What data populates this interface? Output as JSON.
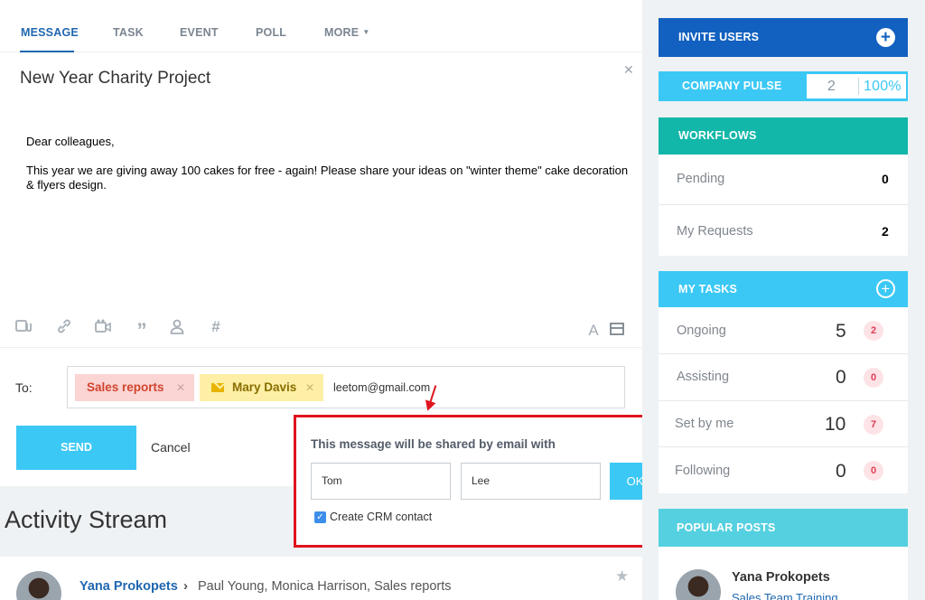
{
  "tabs": [
    {
      "label": "MESSAGE"
    },
    {
      "label": "TASK"
    },
    {
      "label": "EVENT"
    },
    {
      "label": "POLL"
    },
    {
      "label": "MORE"
    }
  ],
  "composer": {
    "title": "New Year Charity Project",
    "greeting": "Dear colleagues,",
    "body": "This year we are giving away 100 cakes for free - again! Please share your ideas on \"winter theme\" cake decoration & flyers design.",
    "to_label": "To:",
    "recipients": {
      "sales": "Sales reports",
      "mary": "Mary Davis",
      "typed_email": "leetom@gmail.com"
    },
    "send_label": "SEND",
    "cancel_label": "Cancel",
    "text_format_glyph": "A"
  },
  "share_popup": {
    "title": "This message will be shared by email with",
    "first_name": "Tom",
    "last_name": "Lee",
    "ok_label": "OK",
    "crm_label": "Create CRM contact",
    "crm_checked": true
  },
  "activity": {
    "title": "Activity Stream",
    "post": {
      "author": "Yana Prokopets",
      "recipients": "Paul Young, Monica Harrison, Sales reports"
    }
  },
  "sidebar": {
    "invite_label": "INVITE USERS",
    "pulse": {
      "label": "COMPANY PULSE",
      "value": "2",
      "percent": "100%"
    },
    "workflows": {
      "label": "WORKFLOWS",
      "rows": [
        {
          "label": "Pending",
          "count": "0"
        },
        {
          "label": "My Requests",
          "count": "2"
        }
      ]
    },
    "tasks": {
      "label": "MY TASKS",
      "rows": [
        {
          "label": "Ongoing",
          "count": "5",
          "badge": "2"
        },
        {
          "label": "Assisting",
          "count": "0",
          "badge": "0"
        },
        {
          "label": "Set by me",
          "count": "10",
          "badge": "7"
        },
        {
          "label": "Following",
          "count": "0",
          "badge": "0"
        }
      ]
    },
    "popular": {
      "label": "POPULAR POSTS",
      "author": "Yana Prokopets",
      "link": "Sales Team Training"
    }
  },
  "colors": {
    "accent_blue": "#2067b0",
    "send_button": "#3bc8f5",
    "invite_header": "#1260bf",
    "workflows_header": "#12b7a9",
    "popular_header": "#55d0e0",
    "highlight_red": "#e0141e"
  }
}
